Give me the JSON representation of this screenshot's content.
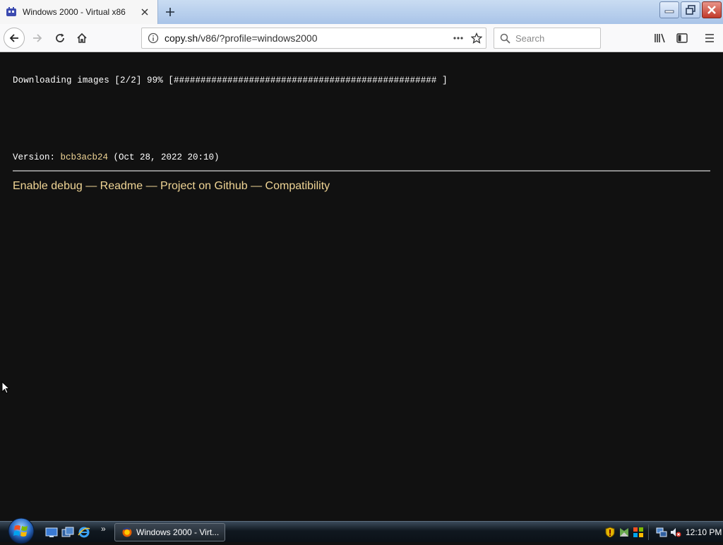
{
  "browser": {
    "tab": {
      "title": "Windows 2000 - Virtual x86",
      "icon": "v86-app-icon"
    },
    "new_tab": "new-tab-icon",
    "window_controls": [
      "minimize-icon",
      "restore-icon",
      "close-icon"
    ],
    "nav": {
      "url_domain": "copy.sh",
      "url_path": "/v86/?profile=windows2000",
      "search_placeholder": "Search"
    },
    "accent": "#c9dcf2"
  },
  "page": {
    "progress_text": "Downloading images [2/2] 99% [################################################# ]",
    "progress_fraction": 0.99,
    "version_label": "Version: ",
    "version_hash": "bcb3acb24",
    "version_date": " (Oct 28, 2022 20:10)",
    "links": {
      "debug": "Enable debug",
      "sep1": " — ",
      "readme": "Readme",
      "sep2": " — ",
      "github": "Project on Github",
      "sep3": " — ",
      "compat": "Compatibility"
    },
    "background": "#111111",
    "link_color": "#f0d595"
  },
  "taskbar": {
    "task_item_label": "Windows 2000 - Virt...",
    "quicklaunch_more": "»",
    "clock": "12:10 PM"
  }
}
